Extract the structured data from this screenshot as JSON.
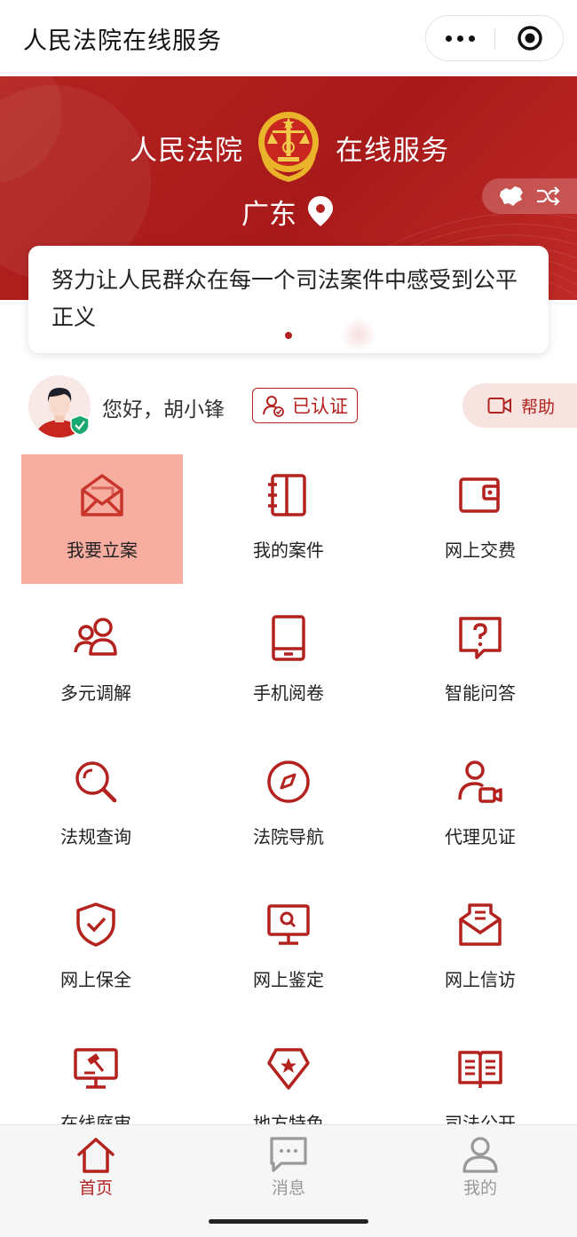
{
  "topbar": {
    "title": "人民法院在线服务"
  },
  "banner": {
    "title_left": "人民法院",
    "title_right": "在线服务",
    "region": "广东",
    "accent_color": "#b3221f"
  },
  "motto": {
    "text": "努力让人民群众在每一个司法案件中感受到公平正义"
  },
  "user": {
    "greeting": "您好，胡小锋",
    "auth_label": "已认证",
    "help_label": "帮助"
  },
  "services": [
    {
      "label": "我要立案",
      "icon": "envelope-icon",
      "active": true
    },
    {
      "label": "我的案件",
      "icon": "notebook-icon"
    },
    {
      "label": "网上交费",
      "icon": "wallet-icon"
    },
    {
      "label": "多元调解",
      "icon": "people-icon"
    },
    {
      "label": "手机阅卷",
      "icon": "tablet-icon"
    },
    {
      "label": "智能问答",
      "icon": "question-bubble-icon"
    },
    {
      "label": "法规查询",
      "icon": "magnifier-icon"
    },
    {
      "label": "法院导航",
      "icon": "compass-icon"
    },
    {
      "label": "代理见证",
      "icon": "person-camera-icon"
    },
    {
      "label": "网上保全",
      "icon": "shield-check-icon"
    },
    {
      "label": "网上鉴定",
      "icon": "monitor-search-icon"
    },
    {
      "label": "网上信访",
      "icon": "mail-letter-icon"
    },
    {
      "label": "在线庭审",
      "icon": "gavel-monitor-icon"
    },
    {
      "label": "地方特色",
      "icon": "star-badge-icon"
    },
    {
      "label": "司法公开",
      "icon": "open-book-icon"
    }
  ],
  "tabbar": {
    "items": [
      {
        "label": "首页",
        "icon": "home-icon",
        "active": true
      },
      {
        "label": "消息",
        "icon": "message-icon",
        "active": false
      },
      {
        "label": "我的",
        "icon": "user-icon",
        "active": false
      }
    ],
    "active_color": "#b3221f",
    "inactive_color": "#999999"
  }
}
